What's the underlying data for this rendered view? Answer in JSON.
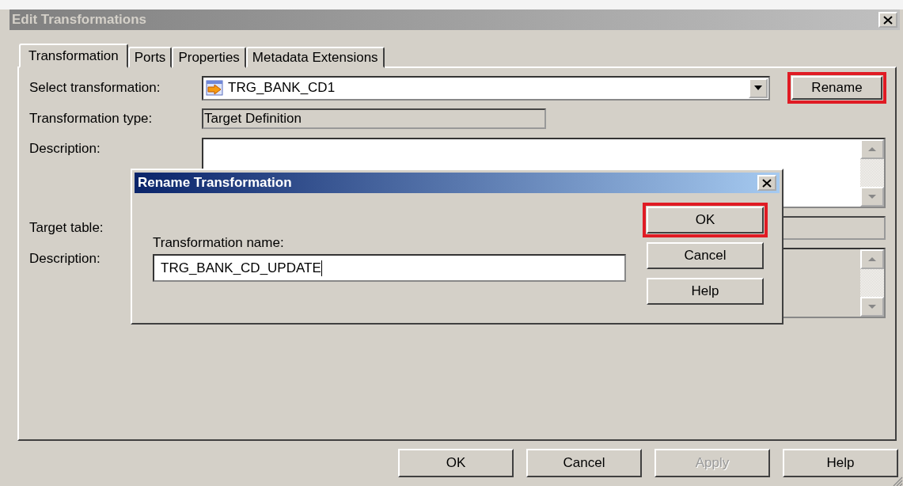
{
  "window": {
    "title": "Edit Transformations"
  },
  "tabs": [
    {
      "label": "Transformation",
      "selected": true
    },
    {
      "label": "Ports",
      "selected": false
    },
    {
      "label": "Properties",
      "selected": false
    },
    {
      "label": "Metadata Extensions",
      "selected": false
    }
  ],
  "select_transformation": {
    "label": "Select transformation:",
    "value": "TRG_BANK_CD1"
  },
  "rename_button": {
    "label": "Rename",
    "highlighted": true
  },
  "transformation_type": {
    "label": "Transformation type:",
    "value": "Target Definition"
  },
  "description": {
    "label": "Description:"
  },
  "target_table": {
    "label": "Target table:"
  },
  "description_2": {
    "label": "Description:"
  },
  "dialog": {
    "title": "Rename Transformation",
    "field_label": "Transformation name:",
    "value": "TRG_BANK_CD_UPDATE",
    "buttons": [
      {
        "label": "OK",
        "highlighted": true
      },
      {
        "label": "Cancel",
        "highlighted": false
      },
      {
        "label": "Help",
        "highlighted": false
      }
    ]
  },
  "buttons": [
    {
      "label": "OK",
      "disabled": false
    },
    {
      "label": "Cancel",
      "disabled": false
    },
    {
      "label": "Apply",
      "disabled": true
    },
    {
      "label": "Help",
      "disabled": false
    }
  ]
}
